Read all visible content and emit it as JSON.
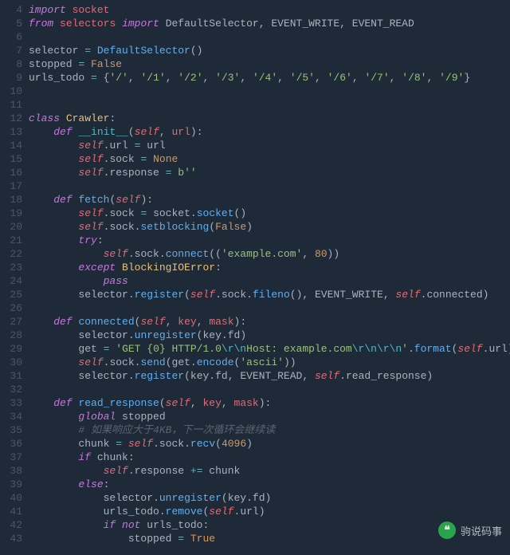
{
  "gutter_start": 4,
  "gutter_end": 43,
  "watermark": {
    "icon_glyph": "❝",
    "text": "驹说码事"
  },
  "code": {
    "l4": [
      [
        "kw",
        "import"
      ],
      [
        "pun",
        " "
      ],
      [
        "mod",
        "socket"
      ]
    ],
    "l5": [
      [
        "kw",
        "from"
      ],
      [
        "pun",
        " "
      ],
      [
        "mod",
        "selectors"
      ],
      [
        "pun",
        " "
      ],
      [
        "kw",
        "import"
      ],
      [
        "pun",
        " "
      ],
      [
        "id",
        "DefaultSelector"
      ],
      [
        "pun",
        ", "
      ],
      [
        "id",
        "EVENT_WRITE"
      ],
      [
        "pun",
        ", "
      ],
      [
        "id",
        "EVENT_READ"
      ]
    ],
    "l6": [],
    "l7": [
      [
        "id",
        "selector "
      ],
      [
        "op",
        "="
      ],
      [
        "id",
        " "
      ],
      [
        "fn",
        "DefaultSelector"
      ],
      [
        "pun",
        "()"
      ]
    ],
    "l8": [
      [
        "id",
        "stopped "
      ],
      [
        "op",
        "="
      ],
      [
        "id",
        " "
      ],
      [
        "bool",
        "False"
      ]
    ],
    "l9": [
      [
        "id",
        "urls_todo "
      ],
      [
        "op",
        "="
      ],
      [
        "id",
        " "
      ],
      [
        "pun",
        "{"
      ],
      [
        "str",
        "'/'"
      ],
      [
        "pun",
        ", "
      ],
      [
        "str",
        "'/1'"
      ],
      [
        "pun",
        ", "
      ],
      [
        "str",
        "'/2'"
      ],
      [
        "pun",
        ", "
      ],
      [
        "str",
        "'/3'"
      ],
      [
        "pun",
        ", "
      ],
      [
        "str",
        "'/4'"
      ],
      [
        "pun",
        ", "
      ],
      [
        "str",
        "'/5'"
      ],
      [
        "pun",
        ", "
      ],
      [
        "str",
        "'/6'"
      ],
      [
        "pun",
        ", "
      ],
      [
        "str",
        "'/7'"
      ],
      [
        "pun",
        ", "
      ],
      [
        "str",
        "'/8'"
      ],
      [
        "pun",
        ", "
      ],
      [
        "str",
        "'/9'"
      ],
      [
        "pun",
        "}"
      ]
    ],
    "l10": [],
    "l11": [],
    "l12": [
      [
        "kw",
        "class"
      ],
      [
        "pun",
        " "
      ],
      [
        "cls",
        "Crawler"
      ],
      [
        "pun",
        ":"
      ]
    ],
    "l13": [
      [
        "pun",
        "    "
      ],
      [
        "kw",
        "def"
      ],
      [
        "pun",
        " "
      ],
      [
        "mag",
        "__init__"
      ],
      [
        "pun",
        "("
      ],
      [
        "self",
        "self"
      ],
      [
        "pun",
        ", "
      ],
      [
        "var",
        "url"
      ],
      [
        "pun",
        "):"
      ]
    ],
    "l14": [
      [
        "pun",
        "        "
      ],
      [
        "self",
        "self"
      ],
      [
        "pun",
        "."
      ],
      [
        "id",
        "url "
      ],
      [
        "op",
        "="
      ],
      [
        "id",
        " url"
      ]
    ],
    "l15": [
      [
        "pun",
        "        "
      ],
      [
        "self",
        "self"
      ],
      [
        "pun",
        "."
      ],
      [
        "id",
        "sock "
      ],
      [
        "op",
        "="
      ],
      [
        "id",
        " "
      ],
      [
        "bool",
        "None"
      ]
    ],
    "l16": [
      [
        "pun",
        "        "
      ],
      [
        "self",
        "self"
      ],
      [
        "pun",
        "."
      ],
      [
        "id",
        "response "
      ],
      [
        "op",
        "="
      ],
      [
        "id",
        " "
      ],
      [
        "str",
        "b"
      ],
      [
        "str",
        "''"
      ]
    ],
    "l17": [],
    "l18": [
      [
        "pun",
        "    "
      ],
      [
        "kw",
        "def"
      ],
      [
        "pun",
        " "
      ],
      [
        "fn",
        "fetch"
      ],
      [
        "pun",
        "("
      ],
      [
        "self",
        "self"
      ],
      [
        "pun",
        "):"
      ]
    ],
    "l19": [
      [
        "pun",
        "        "
      ],
      [
        "self",
        "self"
      ],
      [
        "pun",
        "."
      ],
      [
        "id",
        "sock "
      ],
      [
        "op",
        "="
      ],
      [
        "id",
        " socket"
      ],
      [
        "pun",
        "."
      ],
      [
        "fn",
        "socket"
      ],
      [
        "pun",
        "()"
      ]
    ],
    "l20": [
      [
        "pun",
        "        "
      ],
      [
        "self",
        "self"
      ],
      [
        "pun",
        "."
      ],
      [
        "id",
        "sock"
      ],
      [
        "pun",
        "."
      ],
      [
        "fn",
        "setblocking"
      ],
      [
        "pun",
        "("
      ],
      [
        "bool",
        "False"
      ],
      [
        "pun",
        ")"
      ]
    ],
    "l21": [
      [
        "pun",
        "        "
      ],
      [
        "kw",
        "try"
      ],
      [
        "pun",
        ":"
      ]
    ],
    "l22": [
      [
        "pun",
        "            "
      ],
      [
        "self",
        "self"
      ],
      [
        "pun",
        "."
      ],
      [
        "id",
        "sock"
      ],
      [
        "pun",
        "."
      ],
      [
        "fn",
        "connect"
      ],
      [
        "pun",
        "(("
      ],
      [
        "str",
        "'example.com'"
      ],
      [
        "pun",
        ", "
      ],
      [
        "num",
        "80"
      ],
      [
        "pun",
        "))"
      ]
    ],
    "l23": [
      [
        "pun",
        "        "
      ],
      [
        "kw",
        "except"
      ],
      [
        "pun",
        " "
      ],
      [
        "cls",
        "BlockingIOError"
      ],
      [
        "pun",
        ":"
      ]
    ],
    "l24": [
      [
        "pun",
        "            "
      ],
      [
        "kw",
        "pass"
      ]
    ],
    "l25": [
      [
        "pun",
        "        "
      ],
      [
        "id",
        "selector"
      ],
      [
        "pun",
        "."
      ],
      [
        "fn",
        "register"
      ],
      [
        "pun",
        "("
      ],
      [
        "self",
        "self"
      ],
      [
        "pun",
        "."
      ],
      [
        "id",
        "sock"
      ],
      [
        "pun",
        "."
      ],
      [
        "fn",
        "fileno"
      ],
      [
        "pun",
        "(), "
      ],
      [
        "id",
        "EVENT_WRITE"
      ],
      [
        "pun",
        ", "
      ],
      [
        "self",
        "self"
      ],
      [
        "pun",
        "."
      ],
      [
        "id",
        "connected"
      ],
      [
        "pun",
        ")"
      ]
    ],
    "l26": [],
    "l27": [
      [
        "pun",
        "    "
      ],
      [
        "kw",
        "def"
      ],
      [
        "pun",
        " "
      ],
      [
        "fn",
        "connected"
      ],
      [
        "pun",
        "("
      ],
      [
        "self",
        "self"
      ],
      [
        "pun",
        ", "
      ],
      [
        "var",
        "key"
      ],
      [
        "pun",
        ", "
      ],
      [
        "var",
        "mask"
      ],
      [
        "pun",
        "):"
      ]
    ],
    "l28": [
      [
        "pun",
        "        "
      ],
      [
        "id",
        "selector"
      ],
      [
        "pun",
        "."
      ],
      [
        "fn",
        "unregister"
      ],
      [
        "pun",
        "("
      ],
      [
        "id",
        "key"
      ],
      [
        "pun",
        "."
      ],
      [
        "id",
        "fd"
      ],
      [
        "pun",
        ")"
      ]
    ],
    "l29": [
      [
        "pun",
        "        "
      ],
      [
        "id",
        "get "
      ],
      [
        "op",
        "="
      ],
      [
        "id",
        " "
      ],
      [
        "str",
        "'GET {0} HTTP/1.0"
      ],
      [
        "esc",
        "\\r\\n"
      ],
      [
        "str",
        "Host: example.com"
      ],
      [
        "esc",
        "\\r\\n\\r\\n"
      ],
      [
        "str",
        "'"
      ],
      [
        "pun",
        "."
      ],
      [
        "fn",
        "format"
      ],
      [
        "pun",
        "("
      ],
      [
        "self",
        "self"
      ],
      [
        "pun",
        "."
      ],
      [
        "id",
        "url"
      ],
      [
        "pun",
        ")"
      ]
    ],
    "l30": [
      [
        "pun",
        "        "
      ],
      [
        "self",
        "self"
      ],
      [
        "pun",
        "."
      ],
      [
        "id",
        "sock"
      ],
      [
        "pun",
        "."
      ],
      [
        "fn",
        "send"
      ],
      [
        "pun",
        "("
      ],
      [
        "id",
        "get"
      ],
      [
        "pun",
        "."
      ],
      [
        "fn",
        "encode"
      ],
      [
        "pun",
        "("
      ],
      [
        "str",
        "'ascii'"
      ],
      [
        "pun",
        "))"
      ]
    ],
    "l31": [
      [
        "pun",
        "        "
      ],
      [
        "id",
        "selector"
      ],
      [
        "pun",
        "."
      ],
      [
        "fn",
        "register"
      ],
      [
        "pun",
        "("
      ],
      [
        "id",
        "key"
      ],
      [
        "pun",
        "."
      ],
      [
        "id",
        "fd"
      ],
      [
        "pun",
        ", "
      ],
      [
        "id",
        "EVENT_READ"
      ],
      [
        "pun",
        ", "
      ],
      [
        "self",
        "self"
      ],
      [
        "pun",
        "."
      ],
      [
        "id",
        "read_response"
      ],
      [
        "pun",
        ")"
      ]
    ],
    "l32": [],
    "l33": [
      [
        "pun",
        "    "
      ],
      [
        "kw",
        "def"
      ],
      [
        "pun",
        " "
      ],
      [
        "fn",
        "read_response"
      ],
      [
        "pun",
        "("
      ],
      [
        "self",
        "self"
      ],
      [
        "pun",
        ", "
      ],
      [
        "var",
        "key"
      ],
      [
        "pun",
        ", "
      ],
      [
        "var",
        "mask"
      ],
      [
        "pun",
        "):"
      ]
    ],
    "l34": [
      [
        "pun",
        "        "
      ],
      [
        "kw",
        "global"
      ],
      [
        "pun",
        " "
      ],
      [
        "id",
        "stopped"
      ]
    ],
    "l35": [
      [
        "pun",
        "        "
      ],
      [
        "cmt",
        "# 如果响应大于4KB，下一次循环会继续读"
      ]
    ],
    "l36": [
      [
        "pun",
        "        "
      ],
      [
        "id",
        "chunk "
      ],
      [
        "op",
        "="
      ],
      [
        "id",
        " "
      ],
      [
        "self",
        "self"
      ],
      [
        "pun",
        "."
      ],
      [
        "id",
        "sock"
      ],
      [
        "pun",
        "."
      ],
      [
        "fn",
        "recv"
      ],
      [
        "pun",
        "("
      ],
      [
        "num",
        "4096"
      ],
      [
        "pun",
        ")"
      ]
    ],
    "l37": [
      [
        "pun",
        "        "
      ],
      [
        "kw",
        "if"
      ],
      [
        "pun",
        " "
      ],
      [
        "id",
        "chunk"
      ],
      [
        "pun",
        ":"
      ]
    ],
    "l38": [
      [
        "pun",
        "            "
      ],
      [
        "self",
        "self"
      ],
      [
        "pun",
        "."
      ],
      [
        "id",
        "response "
      ],
      [
        "op",
        "+="
      ],
      [
        "id",
        " chunk"
      ]
    ],
    "l39": [
      [
        "pun",
        "        "
      ],
      [
        "kw",
        "else"
      ],
      [
        "pun",
        ":"
      ]
    ],
    "l40": [
      [
        "pun",
        "            "
      ],
      [
        "id",
        "selector"
      ],
      [
        "pun",
        "."
      ],
      [
        "fn",
        "unregister"
      ],
      [
        "pun",
        "("
      ],
      [
        "id",
        "key"
      ],
      [
        "pun",
        "."
      ],
      [
        "id",
        "fd"
      ],
      [
        "pun",
        ")"
      ]
    ],
    "l41": [
      [
        "pun",
        "            "
      ],
      [
        "id",
        "urls_todo"
      ],
      [
        "pun",
        "."
      ],
      [
        "fn",
        "remove"
      ],
      [
        "pun",
        "("
      ],
      [
        "self",
        "self"
      ],
      [
        "pun",
        "."
      ],
      [
        "id",
        "url"
      ],
      [
        "pun",
        ")"
      ]
    ],
    "l42": [
      [
        "pun",
        "            "
      ],
      [
        "kw",
        "if"
      ],
      [
        "pun",
        " "
      ],
      [
        "kw",
        "not"
      ],
      [
        "pun",
        " "
      ],
      [
        "id",
        "urls_todo"
      ],
      [
        "pun",
        ":"
      ]
    ],
    "l43": [
      [
        "pun",
        "                "
      ],
      [
        "id",
        "stopped "
      ],
      [
        "op",
        "="
      ],
      [
        "id",
        " "
      ],
      [
        "bool",
        "True"
      ]
    ]
  }
}
